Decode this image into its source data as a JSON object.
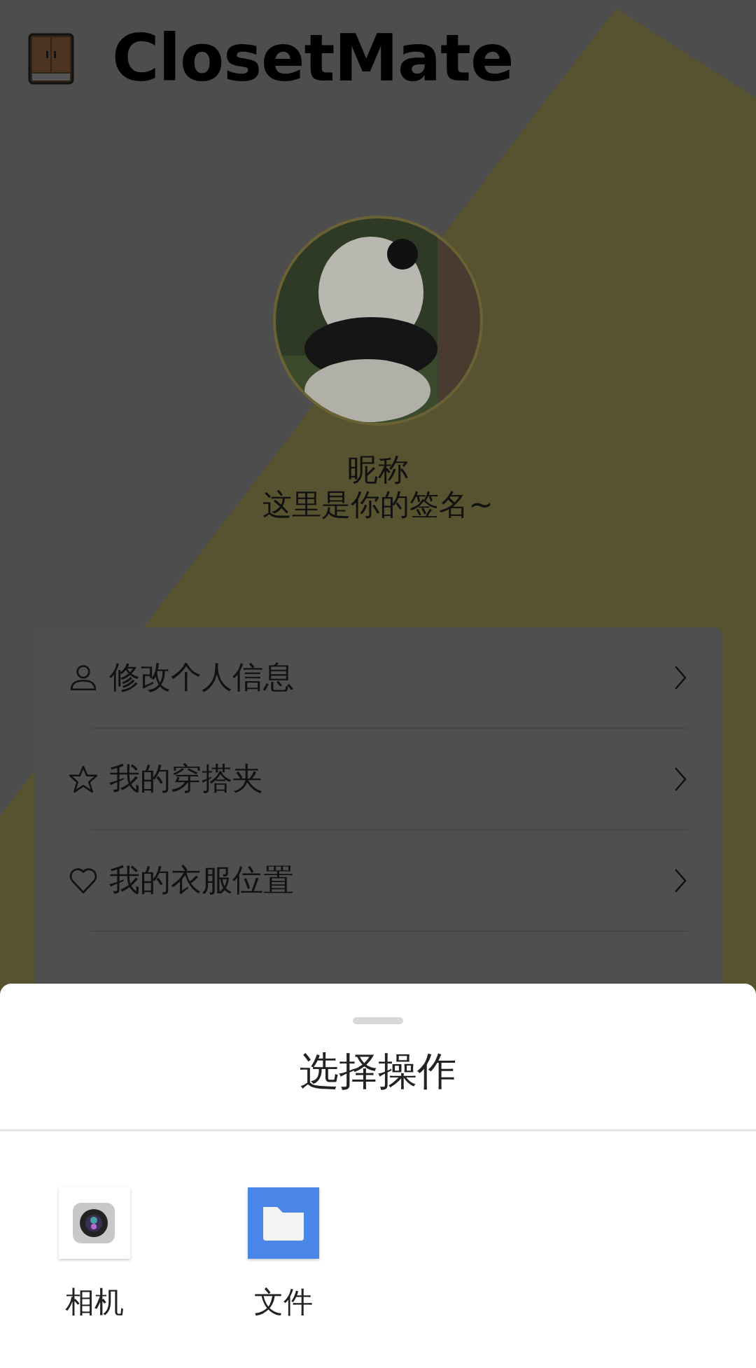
{
  "app": {
    "title": "ClosetMate"
  },
  "profile": {
    "nickname": "昵称",
    "signature": "这里是你的签名~"
  },
  "menu": [
    {
      "kind": "person",
      "label": "修改个人信息"
    },
    {
      "kind": "star",
      "label": "我的穿搭夹"
    },
    {
      "kind": "heart",
      "label": "我的衣服位置"
    }
  ],
  "sheet": {
    "title": "选择操作",
    "options": [
      {
        "kind": "camera",
        "label": "相机"
      },
      {
        "kind": "folder",
        "label": "文件"
      }
    ]
  }
}
